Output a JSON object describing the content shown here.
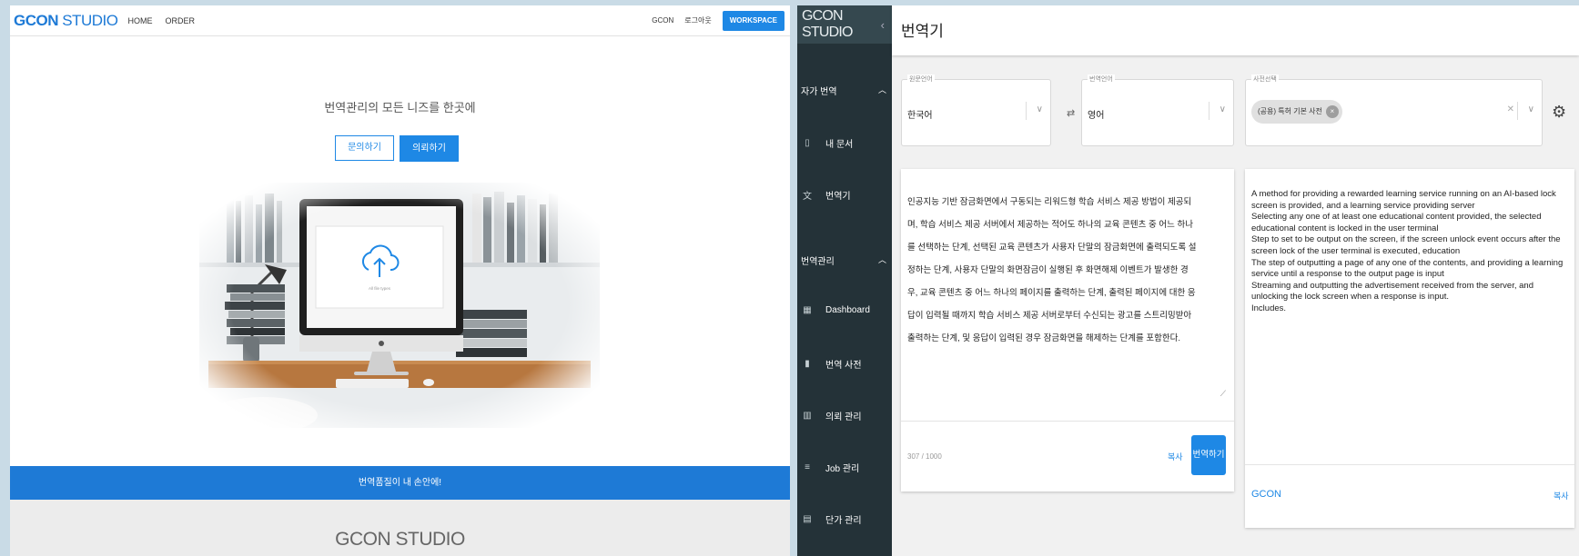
{
  "site": {
    "logo_a": "GCON",
    "logo_b": " STUDIO",
    "nav": [
      "HOME",
      "ORDER"
    ],
    "nav_right": [
      "GCON",
      "로그아웃"
    ],
    "workspace_btn": "WORKSPACE",
    "hero_title": "번역관리의 모든 니즈를 한곳에",
    "btn_inquiry": "문의하기",
    "btn_request": "의뢰하기",
    "upload_caption": "All file types",
    "band_text": "번역품질이 내 손안에!",
    "footer_logo_a": "GCON",
    "footer_logo_b": " STUDIO"
  },
  "app": {
    "logo": "GCON STUDIO",
    "collapse_icon": "chevron-left-icon",
    "sections": [
      {
        "label": "자가 번역"
      },
      {
        "label": "번역관리"
      }
    ],
    "items": [
      {
        "label": "내 문서",
        "icon": "document-icon"
      },
      {
        "label": "번역기",
        "icon": "translate-icon"
      },
      {
        "label": "Dashboard",
        "icon": "dashboard-icon"
      },
      {
        "label": "번역 사전",
        "icon": "dictionary-icon"
      },
      {
        "label": "의뢰 관리",
        "icon": "request-icon"
      },
      {
        "label": "Job 관리",
        "icon": "list-icon"
      },
      {
        "label": "단가 관리",
        "icon": "price-icon"
      }
    ],
    "page_title": "번역기",
    "source_lang": {
      "label": "원문언어",
      "value": "한국어"
    },
    "target_lang": {
      "label": "번역언어",
      "value": "영어"
    },
    "dictionary": {
      "label": "사전선택",
      "chip": "(공용) 특허 기본 사전"
    },
    "source_text": "인공지능 기반 잠금화면에서 구동되는 리워드형 학습 서비스 제공 방법이 제공되며, 학습 서비스 제공 서버에서 제공하는 적어도 하나의 교육 콘텐츠 중 어느 하나를 선택하는 단계, 선택된 교육 콘텐츠가 사용자 단말의 잠금화면에 출력되도록 설정하는 단계, 사용자 단말의 화면잠금이 실행된 후 화면해제 이벤트가 발생한 경우, 교육 콘텐츠 중 어느 하나의 페이지를 출력하는 단계, 출력된 페이지에 대한 응답이 입력될 때까지 학습 서비스 제공 서버로부터 수신되는 광고를 스트리밍받아 출력하는 단계, 및 응답이 입력된 경우 잠금화면을 해제하는 단계를 포함한다.",
    "char_count": "307 / 1000",
    "copy_label": "복사",
    "translate_btn": "번역하기",
    "target_lines": [
      "A method for providing a rewarded learning service running on an AI-based lock screen is provided, and a learning service providing server",
      "Selecting any one of at least one educational content provided, the selected educational content is locked in the user terminal",
      "Step to set to be output on the screen, if the screen unlock event occurs after the screen lock of the user terminal is executed, education",
      "The step of outputting a page of any one of the contents, and providing a learning service until a response to the output page is input",
      "Streaming and outputting the advertisement received from the server, and unlocking the lock screen when a response is input.",
      "Includes."
    ],
    "target_footer": "GCON",
    "target_copy": "복사"
  }
}
